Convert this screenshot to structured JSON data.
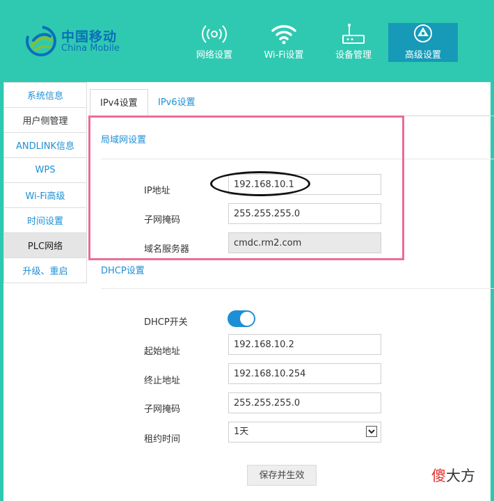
{
  "brand": {
    "name_cn": "中国移动",
    "name_en": "China Mobile",
    "color": "#0a6fb8"
  },
  "nav": [
    {
      "label": "网络设置",
      "icon": "signal-broadcast-icon"
    },
    {
      "label": "Wi-Fi设置",
      "icon": "wifi-icon"
    },
    {
      "label": "设备管理",
      "icon": "router-icon"
    },
    {
      "label": "高级设置",
      "icon": "gear-icon",
      "active": true
    }
  ],
  "sidebar": [
    {
      "label": "系统信息"
    },
    {
      "label": "用户侧管理"
    },
    {
      "label": "ANDLINK信息"
    },
    {
      "label": "WPS"
    },
    {
      "label": "Wi-Fi高级"
    },
    {
      "label": "时间设置"
    },
    {
      "label": "PLC网络",
      "active": true
    },
    {
      "label": "升级、重启"
    }
  ],
  "tabs": [
    {
      "label": "IPv4设置",
      "active": true
    },
    {
      "label": "IPv6设置"
    }
  ],
  "lan": {
    "title": "局域网设置",
    "ip_label": "IP地址",
    "ip_value": "192.168.10.1",
    "mask_label": "子网掩码",
    "mask_value": "255.255.255.0",
    "dns_label": "域名服务器",
    "dns_value": "cmdc.rm2.com"
  },
  "dhcp": {
    "title": "DHCP设置",
    "switch_label": "DHCP开关",
    "switch_on": true,
    "start_label": "起始地址",
    "start_value": "192.168.10.2",
    "end_label": "终止地址",
    "end_value": "192.168.10.254",
    "mask_label": "子网掩码",
    "mask_value": "255.255.255.0",
    "lease_label": "租约时间",
    "lease_value": "1天"
  },
  "save_label": "保存并生效",
  "watermark": {
    "first": "傻",
    "rest": "大方"
  },
  "colors": {
    "header": "#2fc9b1",
    "nav_active": "#169ab8",
    "link": "#1e8fd6",
    "highlight": "#ea6d96"
  }
}
